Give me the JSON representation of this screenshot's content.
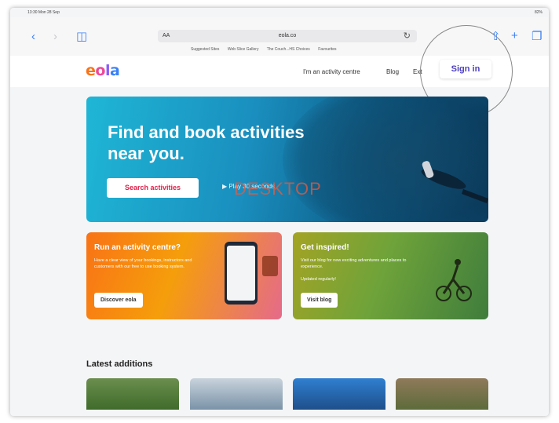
{
  "status": {
    "time": "13:30  Mon 28 Sep",
    "battery": "82%"
  },
  "browser": {
    "address_aa": "AA",
    "url": "eola.co",
    "favourites": [
      "Suggested Sites",
      "Web Slice Gallery",
      "The Couch...HS Choices",
      "Favourites"
    ]
  },
  "site": {
    "logo": {
      "e": "e",
      "o": "o",
      "l": "l",
      "a": "a"
    },
    "nav": {
      "activity_centre": "I'm an activity centre",
      "blog": "Blog",
      "ext": "Ext"
    },
    "signin": "Sign in"
  },
  "hero": {
    "title": "Find and book activities near you.",
    "search_button": "Search activities",
    "play_label": "Play 30 seconds",
    "watermark": "DESKTOP"
  },
  "cards": {
    "centre": {
      "title": "Run an activity centre?",
      "text": "Have a clear view of your bookings, instructors and customers with our free to use booking system.",
      "button": "Discover eola"
    },
    "inspired": {
      "title": "Get inspired!",
      "text": "Visit our blog for new exciting adventures and places to experience.",
      "sub": "Updated regularly!",
      "button": "Visit blog"
    }
  },
  "latest": {
    "title": "Latest additions"
  },
  "colors": {
    "accent": "#3b82f6",
    "signin": "#4c3fbf",
    "cta": "#e11d48"
  }
}
